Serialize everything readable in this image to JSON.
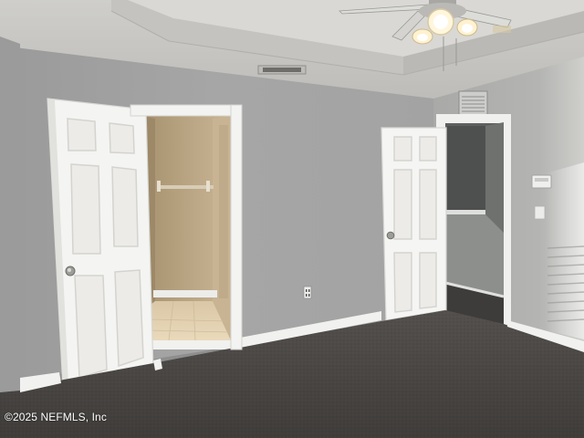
{
  "photo": {
    "subject": "empty-bedroom",
    "watermark": "©2025 NEFMLS, Inc"
  },
  "colors": {
    "wall": "#a3a3a3",
    "wall_right": "#b1b1af",
    "ceiling": "#d6d5d1",
    "carpet": "#4a4745",
    "door": "#f4f4f2",
    "trim": "#f2f2f0",
    "closet_wall": "#b9a488",
    "tile": "#e3d3b6"
  }
}
